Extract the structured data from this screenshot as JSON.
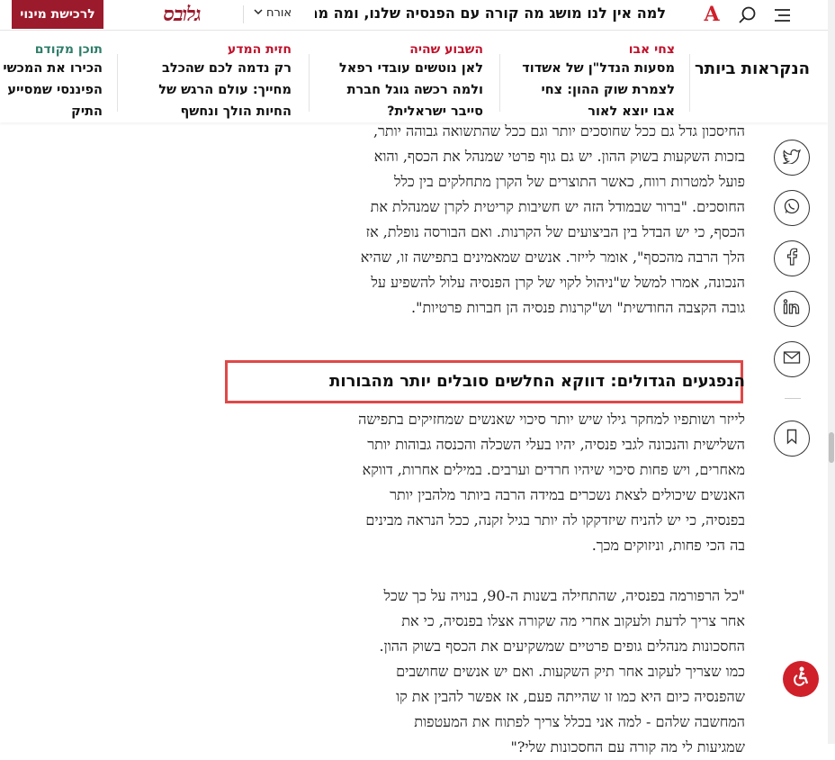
{
  "header": {
    "subscribe_label": "לרכישת מינוי",
    "logo_text": "גלובס",
    "guest_label": "אורח",
    "ticker": "למה אין לנו מושג מה קורה עם הפנסיה שלנו, ומה ממש כד",
    "brand_letter": "A",
    "icons": [
      "menu-icon",
      "search-icon",
      "chevron-down-icon"
    ],
    "brand_color": "#9b1a2c"
  },
  "mostread": {
    "title": "הנקראות ביותר",
    "items": [
      {
        "author": "צחי אבו",
        "lines": [
          "מסעות הנדל\"ן של אשדוד",
          "לצמרת שוק ההון: צחי",
          "אבו יוצא לאור"
        ]
      },
      {
        "author": "השבוע שהיה",
        "lines": [
          "לאן נוטשים עובדי רפאל",
          "ולמה רכשה גוגל חברת",
          "סייבר ישראלית?"
        ]
      },
      {
        "author": "חזית המדע",
        "lines": [
          "רק נדמה לכם שהכלב",
          "מחייך: עולם הרגש של",
          "החיות הולך ונחשף"
        ]
      },
      {
        "author": "תוכן מקודם",
        "lines": [
          "הכירו את המכשי",
          "הפיננסי שמסייע",
          "התיק"
        ]
      }
    ]
  },
  "article": {
    "para1": [
      "החיסכון גדל גם ככל שחוסכים יותר וגם ככל שהתשואה גבוהה יותר,",
      "בזכות השקעות בשוק ההון. יש גם גוף פרטי שמנהל את הכסף, והוא",
      "פועל למטרות רווח, כאשר התוצרים של הקרן מתחלקים בין כלל",
      "החוסכים. \"ברור שבמודל הזה יש חשיבות קריטית לקרן שמנהלת את",
      "הכסף, כי יש הבדל בין הביצועים של הקרנות. ואם הבורסה נופלת, אז",
      "הלך הרבה מהכסף\", אומר לייזר. אנשים שמאמינים בתפישה זו, שהיא",
      "הנכונה, אמרו למשל ש\"ניהול לקוי של קרן הפנסיה עלול להשפיע על",
      "גובה הקצבה החודשית\" וש\"קרנות פנסיה הן חברות פרטיות\"."
    ],
    "subhead": "הנפגעים הגדולים: דווקא החלשים סובלים יותר מהבורות",
    "para2": [
      "לייזר ושותפיו למחקר גילו שיש יותר סיכוי שאנשים שמחזיקים בתפישה",
      "השלישית והנכונה לגבי פנסיה, יהיו בעלי השכלה והכנסה גבוהות יותר",
      "מאחרים, ויש פחות סיכוי שיהיו חרדים וערבים. במילים אחרות, דווקא",
      "האנשים שיכולים לצאת נשכרים במידה הרבה ביותר מלהבין יותר",
      "בפנסיה, כי יש להניח שיזדקקו לה יותר בגיל זקנה, ככל הנראה מבינים",
      "בה הכי פחות, וניזוקים מכך."
    ],
    "para3": [
      "\"כל הרפורמה בפנסיה, שהתחילה בשנות ה-90, בנויה על כך שכל",
      "אחר צריך לדעת ולעקוב אחרי מה שקורה אצלו בפנסיה, כי את",
      "החסכונות מנהלים גופים פרטיים שמשקיעים את הכסף בשוק ההון.",
      "כמו שצריך לעקוב אחר תיק השקעות. ואם יש אנשים שחושבים",
      "שהפנסיה כיום היא כמו זו שהייתה פעם, אז אפשר להבין את קו",
      "המחשבה שלהם - למה אני בכלל צריך לפתוח את המעטפות",
      "שמגיעות לי מה קורה עם החסכונות שלי?\""
    ]
  },
  "share": [
    "twitter-icon",
    "whatsapp-icon",
    "facebook-icon",
    "linkedin-icon",
    "mail-icon",
    "bookmark-icon"
  ]
}
